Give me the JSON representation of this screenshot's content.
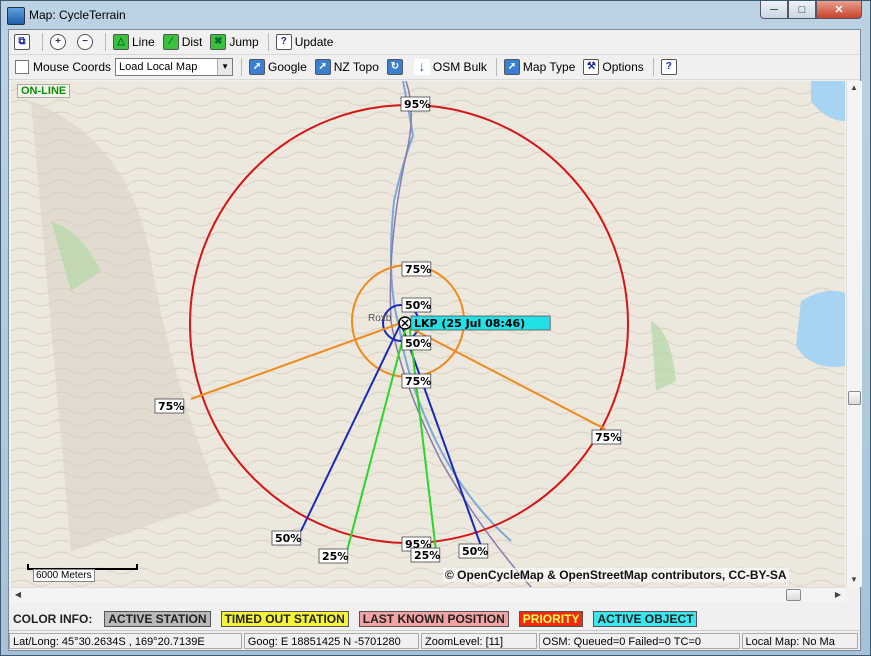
{
  "window": {
    "title": "Map: CycleTerrain"
  },
  "toolbar1": {
    "line_label": "Line",
    "dist_label": "Dist",
    "jump_label": "Jump",
    "update_label": "Update"
  },
  "toolbar2": {
    "mouse_coords_label": "Mouse Coords",
    "map_select_value": "Load Local Map",
    "google_label": "Google",
    "nztopo_label": "NZ Topo",
    "osmbulk_label": "OSM Bulk",
    "maptype_label": "Map Type",
    "options_label": "Options"
  },
  "map": {
    "status": "ON-LINE",
    "scale_label": "6000 Meters",
    "copyright": "© OpenCycleMap & OpenStreetMap contributors, CC-BY-SA",
    "town_label": "Roxb",
    "lkp_label": "LKP (25 Jul 08:46)",
    "ring_labels": {
      "red_95": "95%",
      "orange_75": "75%",
      "blue_50_top": "50%",
      "blue_50_bottom": "50%",
      "orange_75_bottom": "75%",
      "left_75": "75%",
      "right_75": "75%",
      "blue_left_50": "50%",
      "green_left_25": "25%",
      "bottom_95": "95%",
      "green_right_25": "25%",
      "blue_right_50": "50%"
    },
    "colors": {
      "ring95": "#d41616",
      "ring75": "#f08a1c",
      "ring50": "#1a2ab8",
      "ray25": "#29d629",
      "lkp_bg": "#22e0e6"
    }
  },
  "color_info": {
    "title": "COLOR INFO:",
    "chips": [
      {
        "label": "ACTIVE STATION",
        "bg": "#b9b9b9",
        "fg": "#222"
      },
      {
        "label": "TIMED OUT STATION",
        "bg": "#f5f23a",
        "fg": "#222"
      },
      {
        "label": "LAST KNOWN POSITION",
        "bg": "#f2a3a3",
        "fg": "#222"
      },
      {
        "label": "PRIORITY",
        "bg": "#f22a10",
        "fg": "#ffff50"
      },
      {
        "label": "ACTIVE OBJECT",
        "bg": "#3ce6f0",
        "fg": "#222"
      }
    ]
  },
  "status": {
    "latlong": "Lat/Long: 45°30.2634S , 169°20.7139E",
    "goog": "Goog: E 18851425  N -5701280",
    "zoom": "ZoomLevel: [11]",
    "osm": "OSM: Queued=0 Failed=0 TC=0",
    "local": "Local Map: No Ma"
  }
}
